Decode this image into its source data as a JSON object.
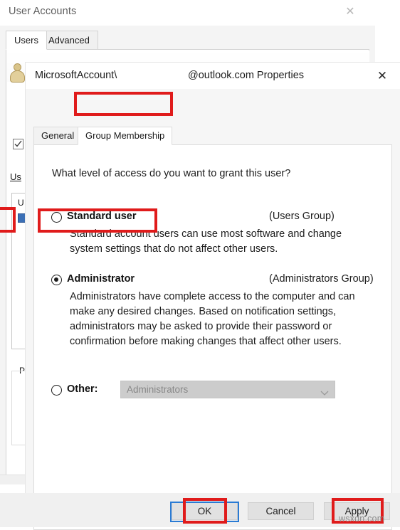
{
  "background_window": {
    "title": "User Accounts",
    "close_icon": "close-icon",
    "tabs": [
      {
        "label": "Users",
        "active": true
      },
      {
        "label": "Advanced",
        "active": false
      }
    ],
    "link_text": "Us",
    "list_column_header": "U",
    "group_label": "P"
  },
  "dialog": {
    "title_prefix": "MicrosoftAccount\\",
    "title_suffix": "@outlook.com Properties",
    "close_icon": "close-icon",
    "tabs": [
      {
        "label": "General",
        "active": false
      },
      {
        "label": "Group Membership",
        "active": true
      }
    ],
    "question": "What level of access do you want to grant this user?",
    "options": [
      {
        "label": "Standard user",
        "group_note": "(Users Group)",
        "selected": false,
        "description": "Standard account users can use most software and change system settings that do not affect other users."
      },
      {
        "label": "Administrator",
        "group_note": "(Administrators Group)",
        "selected": true,
        "description": "Administrators have complete access to the computer and can make any desired changes. Based on notification settings, administrators may be asked to provide their password or confirmation before making changes that affect other users."
      },
      {
        "label": "Other:",
        "group_note": "",
        "selected": false,
        "description": ""
      }
    ],
    "other_combo": {
      "value": "Administrators",
      "enabled": false,
      "arrow_icon": "chevron-down-icon"
    },
    "buttons": {
      "ok": "OK",
      "cancel": "Cancel",
      "apply": "Apply"
    }
  },
  "annotations": {
    "highlight_color": "#e01b1b",
    "focus_color": "#2a7bd4",
    "watermark": "wsxdn.com"
  }
}
